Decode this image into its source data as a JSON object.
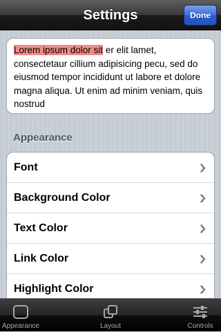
{
  "navbar": {
    "title": "Settings",
    "done_label": "Done"
  },
  "preview": {
    "highlighted": "Lorem ipsum dolor sit",
    "rest": " er elit lamet, consectetaur cillium adipisicing pecu, sed do eiusmod tempor incididunt ut labore et dolore magna aliqua. Ut enim ad minim veniam, quis nostrud",
    "highlight_color": "#f08c84"
  },
  "appearance_section": {
    "header": "Appearance",
    "rows": [
      {
        "label": "Font",
        "icon": "chevron-right-icon"
      },
      {
        "label": "Background Color",
        "icon": "chevron-right-icon"
      },
      {
        "label": "Text Color",
        "icon": "chevron-right-icon"
      },
      {
        "label": "Link Color",
        "icon": "chevron-right-icon"
      },
      {
        "label": "Highlight Color",
        "icon": "chevron-right-icon"
      }
    ]
  },
  "tabbar": {
    "tabs": [
      {
        "label": "Appearance",
        "icon": "square-icon"
      },
      {
        "label": "Layout",
        "icon": "layers-icon"
      },
      {
        "label": "Controls",
        "icon": "sliders-icon"
      }
    ]
  },
  "colors": {
    "done_button": "#2a5bcc",
    "section_header": "#4c566c"
  }
}
